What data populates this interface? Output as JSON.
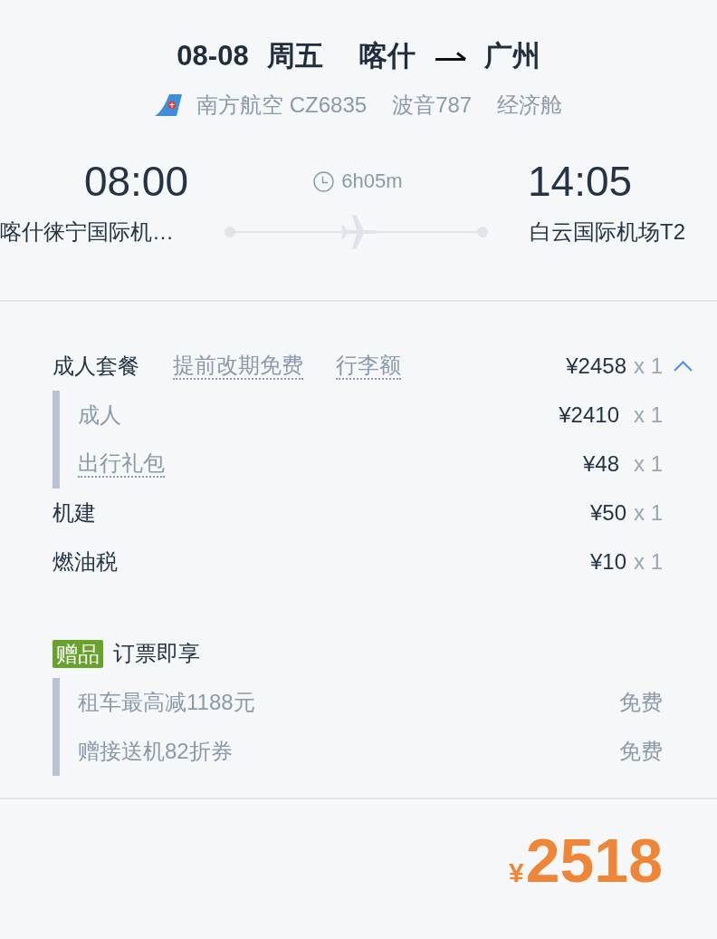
{
  "header": {
    "date": "08-08",
    "weekday": "周五",
    "from": "喀什",
    "to": "广州"
  },
  "flight": {
    "airline": "南方航空",
    "flight_no": "CZ6835",
    "aircraft": "波音787",
    "cabin": "经济舱"
  },
  "schedule": {
    "departure": {
      "time": "08:00",
      "airport": "喀什徕宁国际机…"
    },
    "duration": "6h05m",
    "arrival": {
      "time": "14:05",
      "airport": "白云国际机场T2"
    }
  },
  "fare": {
    "items": [
      {
        "kind": "package",
        "name": "成人套餐",
        "tags": [
          "提前改期免费",
          "行李额"
        ],
        "price": "¥2458",
        "quantity": "x 1",
        "expanded": true,
        "children": [
          {
            "kind": "plain",
            "name": "成人",
            "price": "¥2410",
            "quantity": "x 1"
          },
          {
            "kind": "info",
            "name": "出行礼包",
            "price": "¥48",
            "quantity": "x 1"
          }
        ]
      },
      {
        "kind": "fee",
        "name": "机建",
        "price": "¥50",
        "quantity": "x 1"
      },
      {
        "kind": "fee",
        "name": "燃油税",
        "price": "¥10",
        "quantity": "x 1"
      }
    ]
  },
  "gifts": {
    "badge": "赠品",
    "title": "订票即享",
    "items": [
      {
        "name": "租车最高减1188元",
        "price": "免费"
      },
      {
        "name": "赠接送机82折券",
        "price": "免费"
      }
    ]
  },
  "total": {
    "currency": "¥",
    "amount": "2518"
  }
}
